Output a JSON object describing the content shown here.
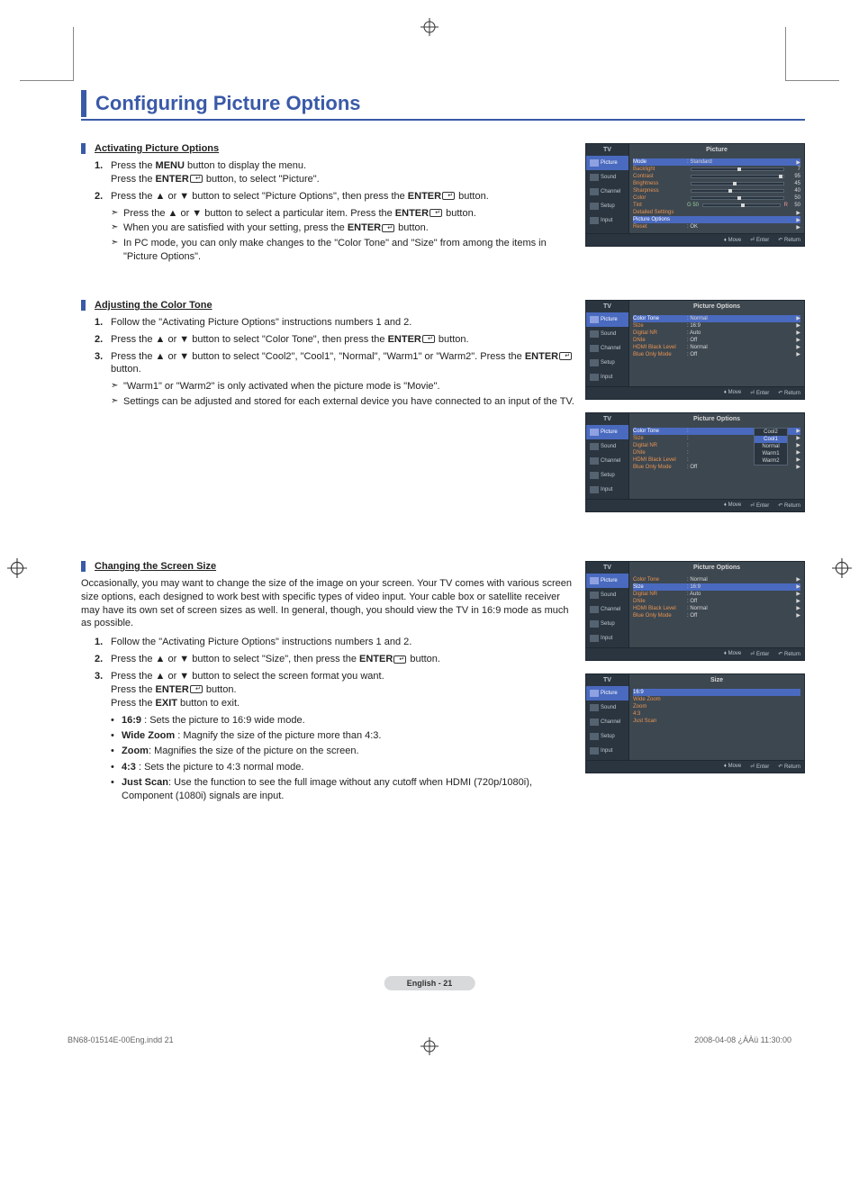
{
  "page": {
    "title": "Configuring Picture Options",
    "label": "English - 21",
    "footer_left": "BN68-01514E-00Eng.indd   21",
    "footer_right": "2008-04-08   ¿ÀÀü 11:30:00"
  },
  "sec1": {
    "heading": "Activating Picture Options",
    "step1a": "Press the ",
    "step1b": " button to display the menu.",
    "step1c": "Press the ",
    "step1d": " button, to select \"Picture\".",
    "step2a": "Press the ▲ or ▼ button to select \"Picture Options\", then press the ",
    "step2b": " button.",
    "note1a": "Press the ▲ or ▼ button to select a particular item. Press the ",
    "note1b": " button.",
    "note2a": "When you are satisfied with your setting, press the ",
    "note2b": " button.",
    "note3": "In PC mode, you can only make changes to the \"Color Tone\" and \"Size\" from among the items in \"Picture Options\".",
    "kw_menu": "MENU",
    "kw_enter": "ENTER"
  },
  "sec2": {
    "heading": "Adjusting the Color Tone",
    "step1": "Follow the \"Activating Picture Options\" instructions numbers 1 and 2.",
    "step2a": "Press the ▲ or ▼ button to select \"Color Tone\", then press the ",
    "step2b": " button.",
    "step3a": "Press the ▲ or ▼ button to select \"Cool2\", \"Cool1\", \"Normal\", \"Warm1\" or \"Warm2\". Press the ",
    "step3b": " button.",
    "note1": "\"Warm1\" or \"Warm2\" is only activated when the picture mode is \"Movie\".",
    "note2": "Settings can be adjusted and stored for each external device you have connected to an input of the TV.",
    "kw_enter": "ENTER"
  },
  "sec3": {
    "heading": "Changing the Screen Size",
    "intro": "Occasionally, you may want to change the size of the image on your screen. Your TV comes with various screen size options, each designed to work best with specific types of video input. Your cable box or satellite receiver may have its own set of screen sizes as well. In general, though, you should view the TV in 16:9 mode as much as possible.",
    "step1": "Follow the \"Activating Picture Options\" instructions numbers 1 and 2.",
    "step2a": "Press the ▲ or ▼ button to select \"Size\", then press the ",
    "step2b": " button.",
    "step3a": "Press the ▲ or ▼ button to select the screen format you want.",
    "step3b": "Press the ",
    "step3c": " button.",
    "step3d": "Press the ",
    "step3e": " button to exit.",
    "kw_enter": "ENTER",
    "kw_exit": "EXIT",
    "b1a": "16:9",
    "b1b": " : Sets the picture to 16:9 wide mode.",
    "b2a": "Wide Zoom",
    "b2b": " : Magnify the size of the picture more than 4:3.",
    "b3a": "Zoom",
    "b3b": ": Magnifies the size of the picture on the screen.",
    "b4a": "4:3",
    "b4b": " : Sets the picture to 4:3 normal mode.",
    "b5a": "Just Scan",
    "b5b": ": Use the function to see the full image without any cutoff when HDMI (720p/1080i), Component (1080i) signals are input."
  },
  "osd": {
    "tv": "TV",
    "nav": [
      "Picture",
      "Sound",
      "Channel",
      "Setup",
      "Input"
    ],
    "foot_move": "Move",
    "foot_enter": "Enter",
    "foot_return": "Return",
    "picture": {
      "title": "Picture",
      "rows": [
        {
          "l": "Mode",
          "v": ": Standard",
          "hl": true,
          "arrow": true
        },
        {
          "l": "Backlight",
          "slider": 50,
          "n": "7"
        },
        {
          "l": "Contrast",
          "slider": 95,
          "n": "95"
        },
        {
          "l": "Brightness",
          "slider": 45,
          "n": "45"
        },
        {
          "l": "Sharpness",
          "slider": 40,
          "n": "40"
        },
        {
          "l": "Color",
          "slider": 50,
          "n": "50"
        },
        {
          "l": "Tint",
          "tint": true,
          "n": "50"
        },
        {
          "l": "Detailed Settings",
          "v": "",
          "arrow": true
        },
        {
          "l": "Picture Options",
          "v": "",
          "hl": true,
          "arrow": true
        },
        {
          "l": "Reset",
          "v": ":  OK",
          "arrow": true
        }
      ],
      "tint_g": "G  50",
      "tint_r": "R"
    },
    "picopt": {
      "title": "Picture Options",
      "rows": [
        {
          "l": "Color Tone",
          "v": ": Normal"
        },
        {
          "l": "Size",
          "v": ": 16:9"
        },
        {
          "l": "Digital NR",
          "v": ": Auto"
        },
        {
          "l": "DNIe",
          "v": ": Off"
        },
        {
          "l": "HDMI Black Level",
          "v": ": Normal"
        },
        {
          "l": "Blue Only Mode",
          "v": ": Off"
        }
      ]
    },
    "picopt_popup": {
      "title": "Picture Options",
      "rows": [
        {
          "l": "Color Tone",
          "v": ":"
        },
        {
          "l": "Size",
          "v": ":"
        },
        {
          "l": "Digital NR",
          "v": ":"
        },
        {
          "l": "DNIe",
          "v": ":"
        },
        {
          "l": "HDMI Black Level",
          "v": ":"
        },
        {
          "l": "Blue Only Mode",
          "v": ": Off"
        }
      ],
      "options": [
        "Cool2",
        "Cool1",
        "Normal",
        "Warm1",
        "Warm2"
      ],
      "sel": 1
    },
    "picopt_size": {
      "title": "Picture Options",
      "rows": [
        {
          "l": "Color Tone",
          "v": ": Normal"
        },
        {
          "l": "Size",
          "v": ": 16:9",
          "hl": true
        },
        {
          "l": "Digital NR",
          "v": ": Auto"
        },
        {
          "l": "DNIe",
          "v": ": Off"
        },
        {
          "l": "HDMI Black Level",
          "v": ": Normal"
        },
        {
          "l": "Blue Only Mode",
          "v": ": Off"
        }
      ]
    },
    "size": {
      "title": "Size",
      "options": [
        "16:9",
        "Wide Zoom",
        "Zoom",
        "4:3",
        "Just Scan"
      ],
      "sel": 0
    }
  }
}
